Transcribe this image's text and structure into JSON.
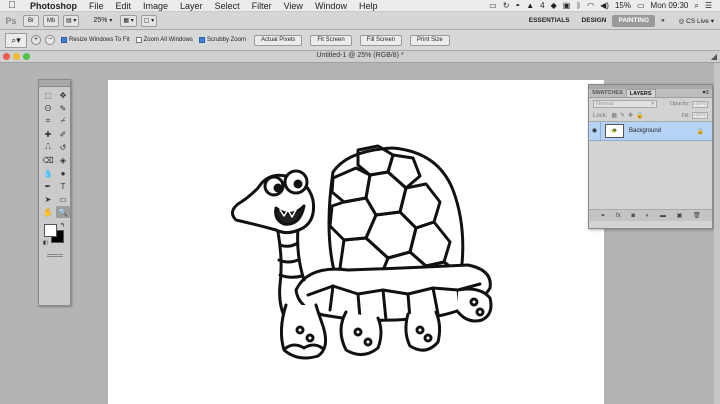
{
  "menubar": {
    "app": "Photoshop",
    "items": [
      "File",
      "Edit",
      "Image",
      "Layer",
      "Select",
      "Filter",
      "View",
      "Window",
      "Help"
    ],
    "status": {
      "adobe_count": "4",
      "battery": "15%",
      "clock": "Mon 09:30"
    }
  },
  "appbar": {
    "logo": "Ps",
    "bridge": "Br",
    "minibridge": "Mb",
    "zoom": "25%",
    "workspaces": [
      "ESSENTIALS",
      "DESIGN",
      "PAINTING"
    ],
    "active_workspace": "PAINTING",
    "more": "»",
    "cslive": "CS Live"
  },
  "options": {
    "resize_windows": "Resize Windows To Fit",
    "zoom_all": "Zoom All Windows",
    "scrubby": "Scrubby Zoom",
    "actual_pixels": "Actual Pixels",
    "fit_screen": "Fit Screen",
    "fill_screen": "Fill Screen",
    "print_size": "Print Size",
    "resize_checked": true,
    "zoom_all_checked": false,
    "scrubby_checked": true
  },
  "document": {
    "title": "Untitled-1 @ 25% (RGB/8) *"
  },
  "tools": [
    "marquee-icon",
    "move-icon",
    "lasso-icon",
    "quick-select-icon",
    "crop-icon",
    "eyedropper-icon",
    "healing-icon",
    "brush-icon",
    "stamp-icon",
    "history-brush-icon",
    "eraser-icon",
    "paint-bucket-icon",
    "blur-icon",
    "dodge-icon",
    "pen-icon",
    "type-icon",
    "path-select-icon",
    "shape-icon",
    "hand-icon",
    "zoom-icon"
  ],
  "tool_glyphs": [
    "⬚",
    "✥",
    "ʘ",
    "✎",
    "⌗",
    "⌿",
    "✚",
    "✐",
    "⎍",
    "↺",
    "⌫",
    "◈",
    "💧",
    "●",
    "✒",
    "T",
    "➤",
    "▭",
    "✋",
    "🔍"
  ],
  "layers_panel": {
    "tabs": [
      "SWATCHES",
      "LAYERS"
    ],
    "active_tab": "LAYERS",
    "blend_mode": "Normal",
    "opacity_label": "Opacity:",
    "opacity_value": "100%",
    "lock_label": "Lock:",
    "fill_label": "Fill:",
    "fill_value": "100%",
    "layer_name": "Background"
  }
}
